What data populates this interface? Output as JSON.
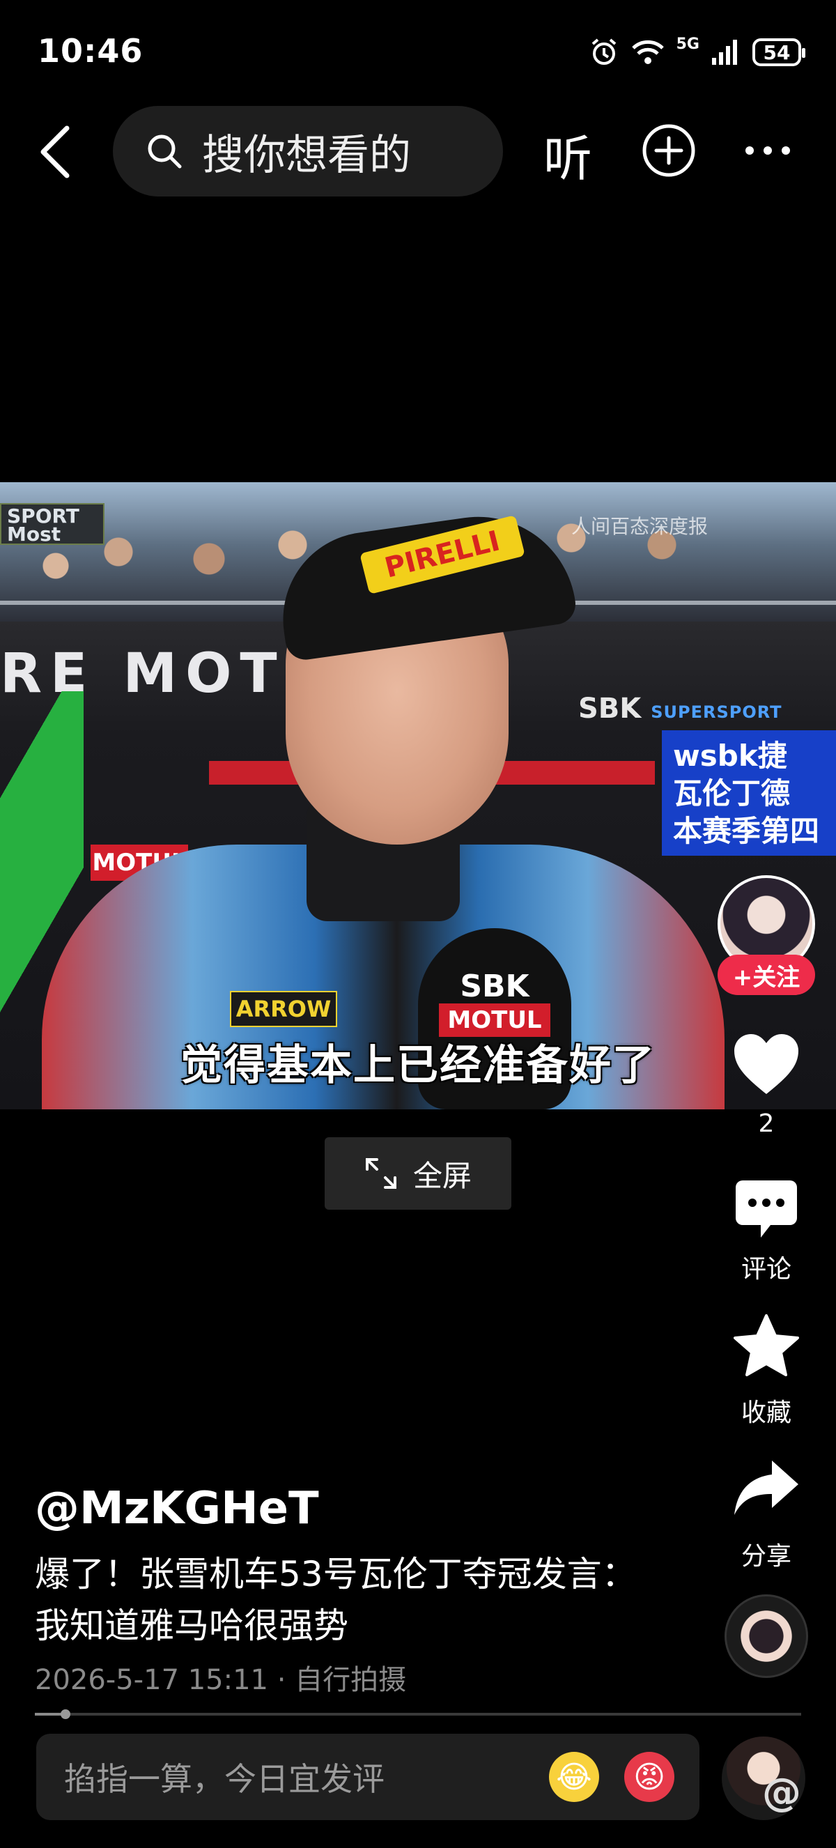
{
  "status_bar": {
    "time": "10:46",
    "network": "5G",
    "battery": "54"
  },
  "nav": {
    "search_placeholder": "搜你想看的",
    "listen_label": "听"
  },
  "video": {
    "subtitle": "觉得基本上已经准备好了",
    "news_overlay": "wsbk捷\n瓦伦丁德\n本赛季第四",
    "watermark": "人间百态深度报",
    "bg_text_sport": "SPORT\nMost",
    "bg_text_moto": "RE MOTO   RT",
    "bg_sbk": "SBK",
    "bg_sbk_sub": "SUPERSPORT",
    "cap_brand": "PIRELLI",
    "mic_text": "SBK",
    "mic_sub": "MOTUL",
    "motul": "MOTUL",
    "arrow_patch": "ARROW"
  },
  "fullscreen_label": "全屏",
  "actions": {
    "follow": "+关注",
    "like_count": "2",
    "comment_label": "评论",
    "favorite_label": "收藏",
    "share_label": "分享"
  },
  "post": {
    "author": "@MzKGHeT",
    "title": "爆了！张雪机车53号瓦伦丁夺冠发言：我知道雅马哈很强势",
    "datetime": "2026-5-17 15:11",
    "source": "自行拍摄",
    "progress": 0.04
  },
  "comment_bar": {
    "placeholder": "掐指一算，今日宜发评"
  },
  "icons": [
    "back-icon",
    "search-icon",
    "add-circle-icon",
    "more-icon",
    "fullscreen-icon",
    "heart-icon",
    "comment-icon",
    "star-icon",
    "share-icon",
    "emoji-cry-icon",
    "emoji-angry-icon"
  ],
  "colors": {
    "background": "#000000",
    "follow": "#ee2c4a",
    "searchbox": "#1e1e1e"
  }
}
